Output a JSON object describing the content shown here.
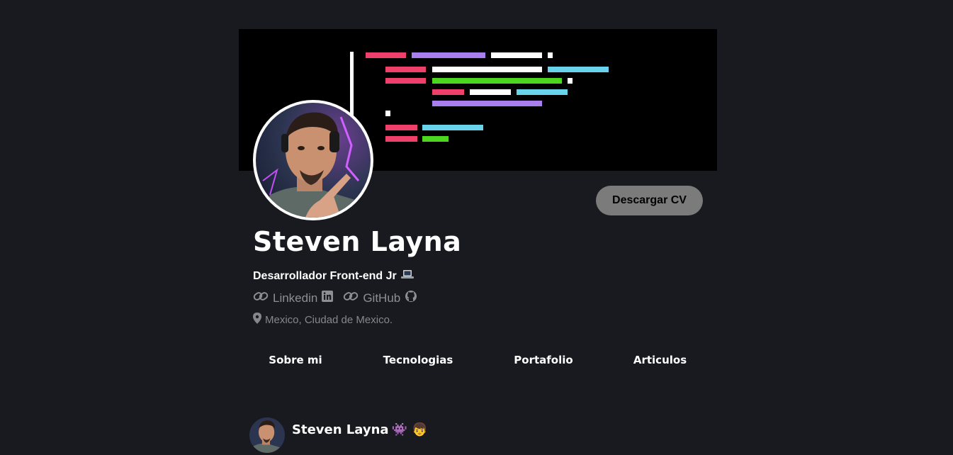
{
  "profile": {
    "name": "Steven Layna",
    "role": "Desarrollador Front-end Jr",
    "role_icon": "laptop-icon",
    "location": "Mexico, Ciudad de Mexico."
  },
  "actions": {
    "download_cv_label": "Descargar CV"
  },
  "links": [
    {
      "label": "Linkedin",
      "icon": "linkedin-icon"
    },
    {
      "label": "GitHub",
      "icon": "github-icon"
    }
  ],
  "tabs": [
    {
      "label": "Sobre mi"
    },
    {
      "label": "Tecnologias"
    },
    {
      "label": "Portafolio"
    },
    {
      "label": "Articulos"
    }
  ],
  "post": {
    "author": "Steven Layna",
    "emojis": "👾 👦"
  },
  "colors": {
    "background": "#181a1f",
    "banner": "#000000",
    "code_pink": "#ef3f6b",
    "code_purple": "#a97ff0",
    "code_white": "#ffffff",
    "code_cyan": "#6ad3ec",
    "code_green": "#4cd61f",
    "button": "#7b7b7b",
    "muted_text": "#8d8f94"
  }
}
